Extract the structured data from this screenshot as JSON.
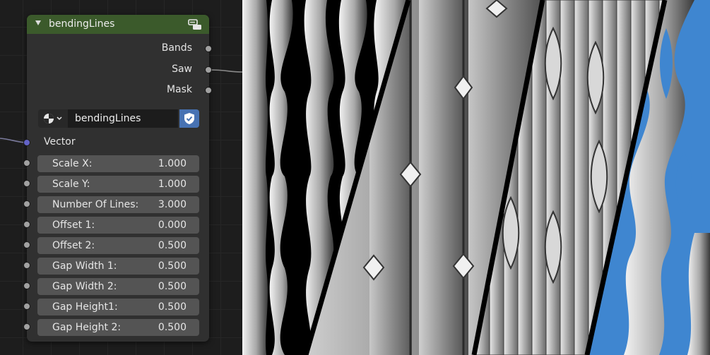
{
  "node": {
    "title": "bendingLines",
    "outputs": [
      {
        "label": "Bands"
      },
      {
        "label": "Saw"
      },
      {
        "label": "Mask"
      }
    ],
    "node_tree": "bendingLines",
    "vector_label": "Vector",
    "fields": [
      {
        "label": "Scale X:",
        "value": "1.000"
      },
      {
        "label": "Scale Y:",
        "value": "1.000"
      },
      {
        "label": "Number Of Lines:",
        "value": "3.000"
      },
      {
        "label": "Offset 1:",
        "value": "0.000"
      },
      {
        "label": "Offset 2:",
        "value": "0.500"
      },
      {
        "label": "Gap Width 1:",
        "value": "0.500"
      },
      {
        "label": "Gap Width 2:",
        "value": "0.500"
      },
      {
        "label": "Gap Height1:",
        "value": "0.500"
      },
      {
        "label": "Gap Height 2:",
        "value": "0.500"
      }
    ]
  },
  "colors": {
    "header": "#3b5a2b",
    "node_body": "#303030",
    "field_bg": "#545454",
    "socket_float": "#a1a1a1",
    "socket_vector": "#6363c7",
    "fake_user_blue": "#4772b3",
    "render_blue": "#3f86d0"
  },
  "icons": {
    "collapse": "triangle-down-icon",
    "node_group": "node-group-icon",
    "node_tree_type": "node-tree-icon",
    "fake_user": "shield-check-icon"
  }
}
